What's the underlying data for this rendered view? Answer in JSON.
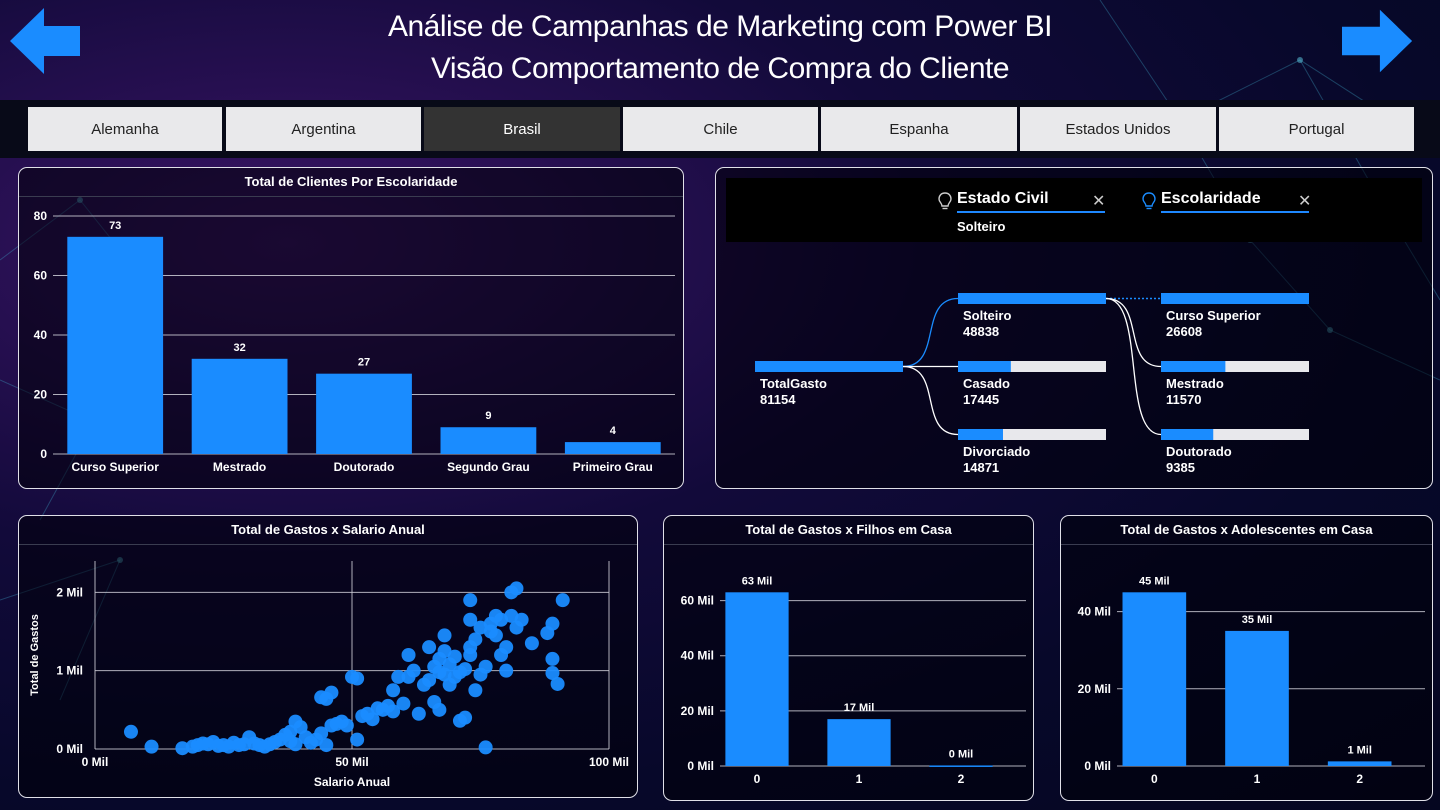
{
  "header": {
    "title_line1": "Análise de Campanhas de Marketing com Power BI",
    "title_line2": "Visão Comportamento de Compra do Cliente",
    "prev_icon": "arrow-left-icon",
    "next_icon": "arrow-right-icon"
  },
  "tabs": [
    {
      "label": "Alemanha",
      "active": false
    },
    {
      "label": "Argentina",
      "active": false
    },
    {
      "label": "Brasil",
      "active": true
    },
    {
      "label": "Chile",
      "active": false
    },
    {
      "label": "Espanha",
      "active": false
    },
    {
      "label": "Estados Unidos",
      "active": false
    },
    {
      "label": "Portugal",
      "active": false
    }
  ],
  "colors": {
    "accent": "#1a8cff",
    "bar": "#1a8cff",
    "bar_bg": "#e8e8ec",
    "grid": "#cfcfd8"
  },
  "escolaridade_chart": {
    "title": "Total de Clientes Por Escolaridade",
    "chart_data": {
      "type": "bar",
      "categories": [
        "Curso Superior",
        "Mestrado",
        "Doutorado",
        "Segundo Grau",
        "Primeiro Grau"
      ],
      "values": [
        73,
        32,
        27,
        9,
        4
      ],
      "data_labels": [
        "73",
        "32",
        "27",
        "9",
        "4"
      ],
      "yticks": [
        "0",
        "20",
        "40",
        "60",
        "80"
      ],
      "ylim": [
        0,
        80
      ]
    }
  },
  "decomp_tree": {
    "filter1": {
      "label": "Estado Civil",
      "value": "Solteiro",
      "icon": "lightbulb-icon",
      "close_icon": "close-icon"
    },
    "filter2": {
      "label": "Escolaridade",
      "icon": "lightbulb-icon",
      "close_icon": "close-icon"
    },
    "root": {
      "label": "TotalGasto",
      "value": "81154",
      "fraction": 1.0
    },
    "level1": [
      {
        "label": "Solteiro",
        "value": "48838",
        "fraction": 1.0,
        "selected": true
      },
      {
        "label": "Casado",
        "value": "17445",
        "fraction": 0.357
      },
      {
        "label": "Divorciado",
        "value": "14871",
        "fraction": 0.304
      }
    ],
    "level2": [
      {
        "label": "Curso Superior",
        "value": "26608",
        "fraction": 1.0
      },
      {
        "label": "Mestrado",
        "value": "11570",
        "fraction": 0.435
      },
      {
        "label": "Doutorado",
        "value": "9385",
        "fraction": 0.353
      }
    ]
  },
  "scatter_chart": {
    "title": "Total de Gastos x Salario Anual",
    "xlabel": "Salario Anual",
    "ylabel": "Total de Gastos",
    "chart_data": {
      "type": "scatter",
      "xticks": [
        "0 Mil",
        "50 Mil",
        "100 Mil"
      ],
      "yticks": [
        "0 Mil",
        "1 Mil",
        "2 Mil"
      ],
      "xlim": [
        0,
        100
      ],
      "ylim": [
        0,
        2.4
      ],
      "points": [
        [
          7,
          0.22
        ],
        [
          11,
          0.03
        ],
        [
          17,
          0.01
        ],
        [
          19,
          0.03
        ],
        [
          20,
          0.05
        ],
        [
          21,
          0.07
        ],
        [
          22,
          0.06
        ],
        [
          23,
          0.09
        ],
        [
          24,
          0.04
        ],
        [
          25,
          0.05
        ],
        [
          26,
          0.03
        ],
        [
          27,
          0.08
        ],
        [
          28,
          0.05
        ],
        [
          29,
          0.06
        ],
        [
          30,
          0.15
        ],
        [
          31,
          0.07
        ],
        [
          32,
          0.05
        ],
        [
          33,
          0.03
        ],
        [
          34,
          0.06
        ],
        [
          35,
          0.09
        ],
        [
          36,
          0.12
        ],
        [
          37,
          0.18
        ],
        [
          38,
          0.22
        ],
        [
          38,
          0.1
        ],
        [
          39,
          0.35
        ],
        [
          39,
          0.06
        ],
        [
          40,
          0.28
        ],
        [
          41,
          0.15
        ],
        [
          42,
          0.08
        ],
        [
          43,
          0.12
        ],
        [
          44,
          0.2
        ],
        [
          45,
          0.05
        ],
        [
          44,
          0.66
        ],
        [
          45,
          0.64
        ],
        [
          46,
          0.72
        ],
        [
          46,
          0.3
        ],
        [
          47,
          0.32
        ],
        [
          48,
          0.35
        ],
        [
          49,
          0.3
        ],
        [
          50,
          0.92
        ],
        [
          51,
          0.9
        ],
        [
          51,
          0.12
        ],
        [
          52,
          0.42
        ],
        [
          53,
          0.45
        ],
        [
          54,
          0.38
        ],
        [
          55,
          0.52
        ],
        [
          56,
          0.5
        ],
        [
          57,
          0.55
        ],
        [
          58,
          0.75
        ],
        [
          58,
          0.48
        ],
        [
          59,
          0.92
        ],
        [
          60,
          0.58
        ],
        [
          61,
          0.92
        ],
        [
          61,
          1.2
        ],
        [
          62,
          1.0
        ],
        [
          63,
          0.45
        ],
        [
          64,
          0.82
        ],
        [
          65,
          0.88
        ],
        [
          65,
          1.3
        ],
        [
          66,
          1.05
        ],
        [
          66,
          0.6
        ],
        [
          67,
          0.98
        ],
        [
          67,
          1.15
        ],
        [
          67,
          0.5
        ],
        [
          68,
          0.95
        ],
        [
          68,
          1.25
        ],
        [
          68,
          1.45
        ],
        [
          69,
          0.82
        ],
        [
          69,
          1.08
        ],
        [
          70,
          0.92
        ],
        [
          70,
          1.18
        ],
        [
          71,
          0.98
        ],
        [
          71,
          0.36
        ],
        [
          72,
          1.02
        ],
        [
          72,
          0.4
        ],
        [
          73,
          1.3
        ],
        [
          73,
          1.2
        ],
        [
          73,
          1.65
        ],
        [
          73,
          1.9
        ],
        [
          74,
          0.75
        ],
        [
          74,
          1.4
        ],
        [
          75,
          0.95
        ],
        [
          75,
          1.55
        ],
        [
          76,
          1.05
        ],
        [
          76,
          0.02
        ],
        [
          77,
          1.5
        ],
        [
          77,
          1.6
        ],
        [
          78,
          1.7
        ],
        [
          78,
          1.45
        ],
        [
          79,
          1.65
        ],
        [
          79,
          1.2
        ],
        [
          80,
          1.0
        ],
        [
          80,
          1.3
        ],
        [
          81,
          1.7
        ],
        [
          81,
          2.0
        ],
        [
          82,
          1.55
        ],
        [
          82,
          2.05
        ],
        [
          83,
          1.65
        ],
        [
          88,
          1.48
        ],
        [
          89,
          1.15
        ],
        [
          89,
          0.97
        ],
        [
          90,
          0.83
        ],
        [
          91,
          1.9
        ],
        [
          89,
          1.6
        ],
        [
          85,
          1.35
        ]
      ]
    }
  },
  "filhos_chart": {
    "title": "Total de Gastos x Filhos em Casa",
    "chart_data": {
      "type": "bar",
      "categories": [
        "0",
        "1",
        "2"
      ],
      "values": [
        63,
        17,
        0.2
      ],
      "data_labels": [
        "63 Mil",
        "17 Mil",
        "0 Mil"
      ],
      "yticks": [
        "0 Mil",
        "20 Mil",
        "40 Mil",
        "60 Mil"
      ],
      "ylim": [
        0,
        70
      ]
    }
  },
  "adolescentes_chart": {
    "title": "Total de Gastos x Adolescentes em Casa",
    "chart_data": {
      "type": "bar",
      "categories": [
        "0",
        "1",
        "2"
      ],
      "values": [
        45,
        35,
        1.2
      ],
      "data_labels": [
        "45 Mil",
        "35 Mil",
        "1 Mil"
      ],
      "yticks": [
        "0 Mil",
        "20 Mil",
        "40 Mil"
      ],
      "ylim": [
        0,
        50
      ]
    }
  }
}
